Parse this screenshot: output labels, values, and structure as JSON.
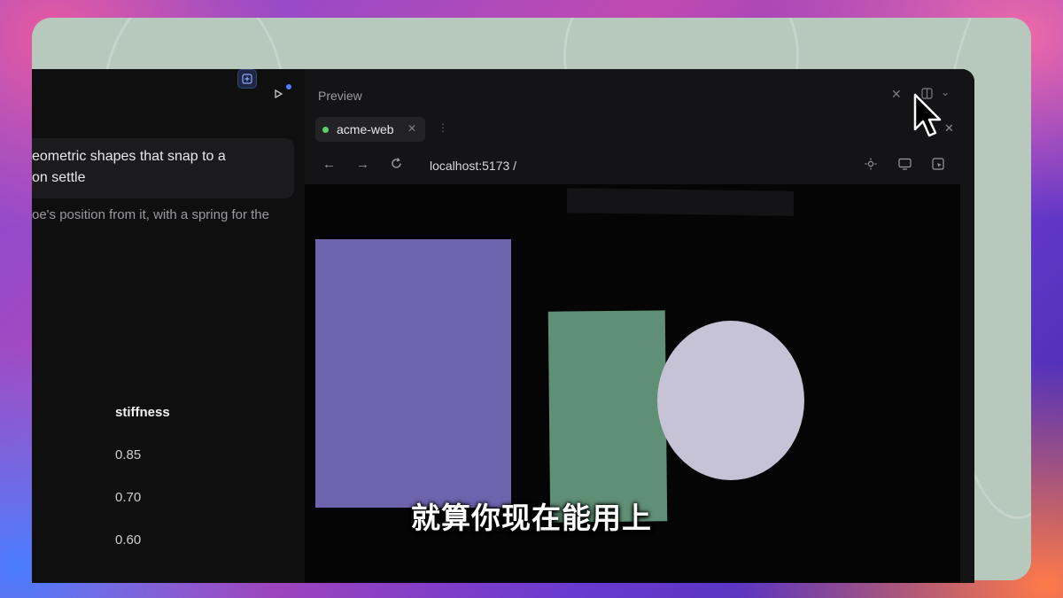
{
  "chat": {
    "message_lines": [
      "eometric shapes that snap to a",
      "on settle"
    ],
    "reply_line": "oe's position from it, with a spring for the",
    "table": {
      "header": "stiffness",
      "values": [
        "0.85",
        "0.70",
        "0.60"
      ]
    },
    "toolbar": {
      "new_icon": "new-chat-icon",
      "run_icon": "play-icon"
    }
  },
  "preview": {
    "title": "Preview",
    "tab": {
      "label": "acme-web",
      "status_color": "#5fcf6a"
    },
    "url": "localhost:5173 /",
    "shapes": [
      {
        "kind": "rectangle",
        "color": "#6e63ad"
      },
      {
        "kind": "rectangle",
        "color": "#5f8f74"
      },
      {
        "kind": "circle",
        "color": "#c6c3d6"
      }
    ]
  },
  "caption": "就算你现在能用上",
  "colors": {
    "accent": "#4f7dff",
    "window_bg": "#0c0c0d",
    "wallpaper_panel": "#b7c8bd"
  }
}
